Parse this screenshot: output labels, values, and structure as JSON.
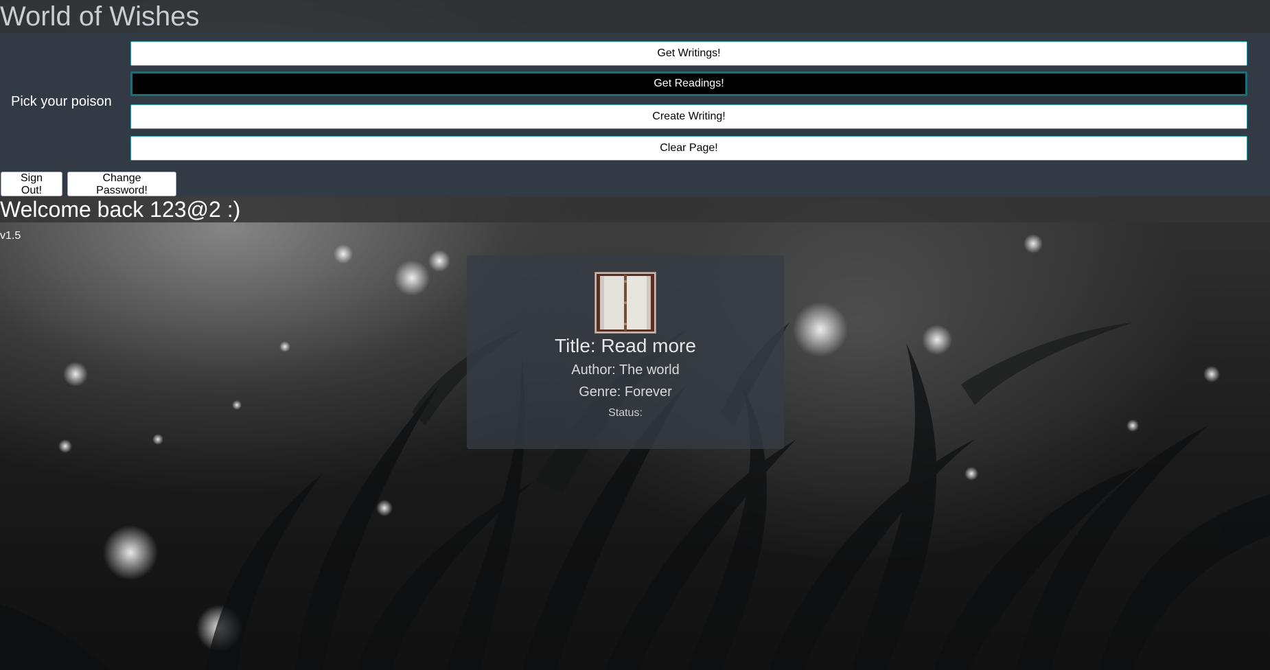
{
  "app": {
    "title": "World of Wishes"
  },
  "controls": {
    "label": "Pick your poison",
    "buttons": [
      {
        "label": "Get Writings!"
      },
      {
        "label": "Get Readings!"
      },
      {
        "label": "Create Writing!"
      },
      {
        "label": "Clear Page!"
      }
    ],
    "active_index": 1
  },
  "account": {
    "sign_out_label": "Sign Out!",
    "change_password_label": "Change Password!"
  },
  "greeting": "Welcome back 123@2 :)",
  "version": "v1.5",
  "card": {
    "title": "Title: Read more",
    "author": "Author: The world",
    "genre": "Genre: Forever",
    "status": "Status:"
  },
  "icons": {
    "card_image": "open-book-icon"
  },
  "colors": {
    "panel": "#323b45",
    "button_border": "#2a9fa7",
    "active_button": "#000000",
    "card": "#343c44"
  }
}
